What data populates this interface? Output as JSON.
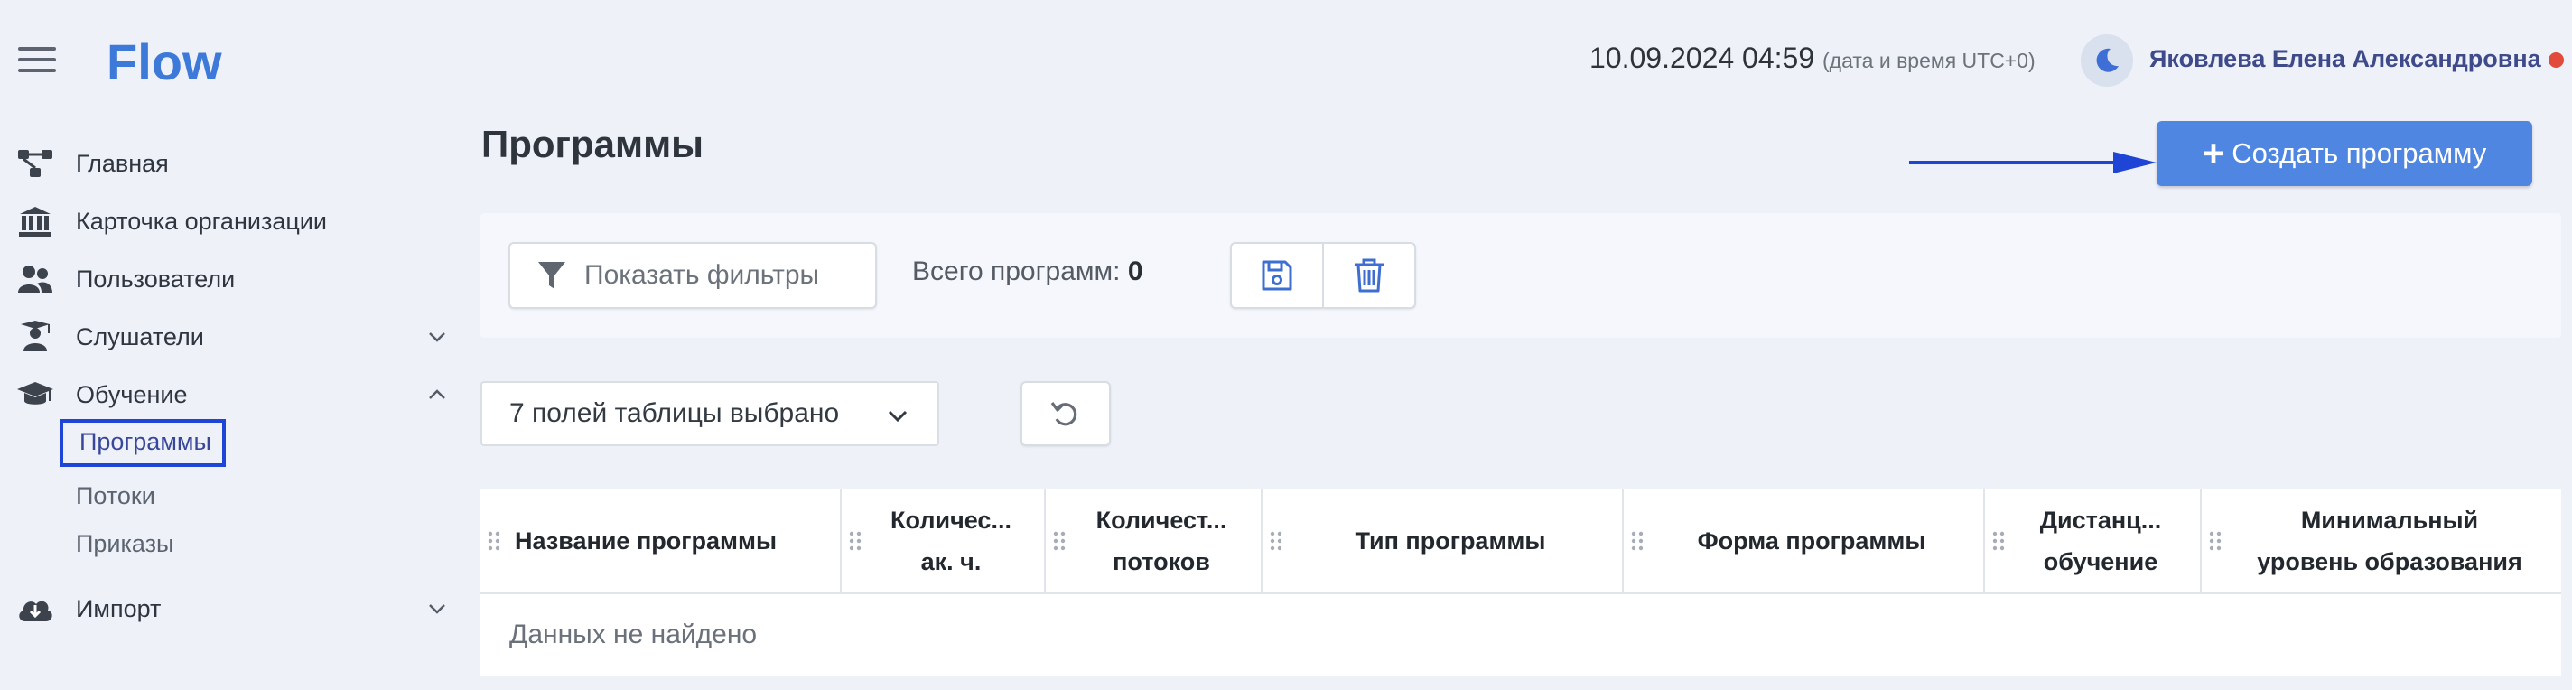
{
  "app": {
    "logo": "Flow"
  },
  "header": {
    "datetime": "10.09.2024 04:59",
    "timezone_note": "(дата и время UTC+0)",
    "user_name": "Яковлева Елена Александровна",
    "status_color": "#e24b3b",
    "theme_icon": "moon-icon"
  },
  "sidebar": {
    "items": [
      {
        "label": "Главная",
        "icon": "hierarchy-icon"
      },
      {
        "label": "Карточка организации",
        "icon": "bank-icon"
      },
      {
        "label": "Пользователи",
        "icon": "users-icon"
      },
      {
        "label": "Слушатели",
        "icon": "teacher-icon",
        "expanded": false
      },
      {
        "label": "Обучение",
        "icon": "graduation-cap-icon",
        "expanded": true
      },
      {
        "label": "Импорт",
        "icon": "cloud-download-icon",
        "expanded": false
      }
    ],
    "learning_sub": [
      {
        "label": "Программы",
        "active": true
      },
      {
        "label": "Потоки"
      },
      {
        "label": "Приказы"
      }
    ]
  },
  "main": {
    "title": "Программы",
    "create_button": "Создать программу",
    "create_icon": "plus-icon",
    "filter_button": "Показать фильтры",
    "total_label": "Всего программ:",
    "total_value": "0",
    "columns_select": "7 полей таблицы выбрано",
    "table": {
      "columns": [
        {
          "line1": "Название программы",
          "line2": ""
        },
        {
          "line1": "Количес...",
          "line2": "ак. ч."
        },
        {
          "line1": "Количест...",
          "line2": "потоков"
        },
        {
          "line1": "Тип программы",
          "line2": ""
        },
        {
          "line1": "Форма программы",
          "line2": ""
        },
        {
          "line1": "Дистанц...",
          "line2": "обучение"
        },
        {
          "line1": "Минимальный",
          "line2": "уровень образования"
        }
      ],
      "empty_text": "Данных не найдено"
    }
  },
  "colors": {
    "accent": "#4f86e1",
    "logo": "#3d79d8",
    "highlight_box": "#1f45d6",
    "annotation_arrow": "#1f45d6"
  }
}
